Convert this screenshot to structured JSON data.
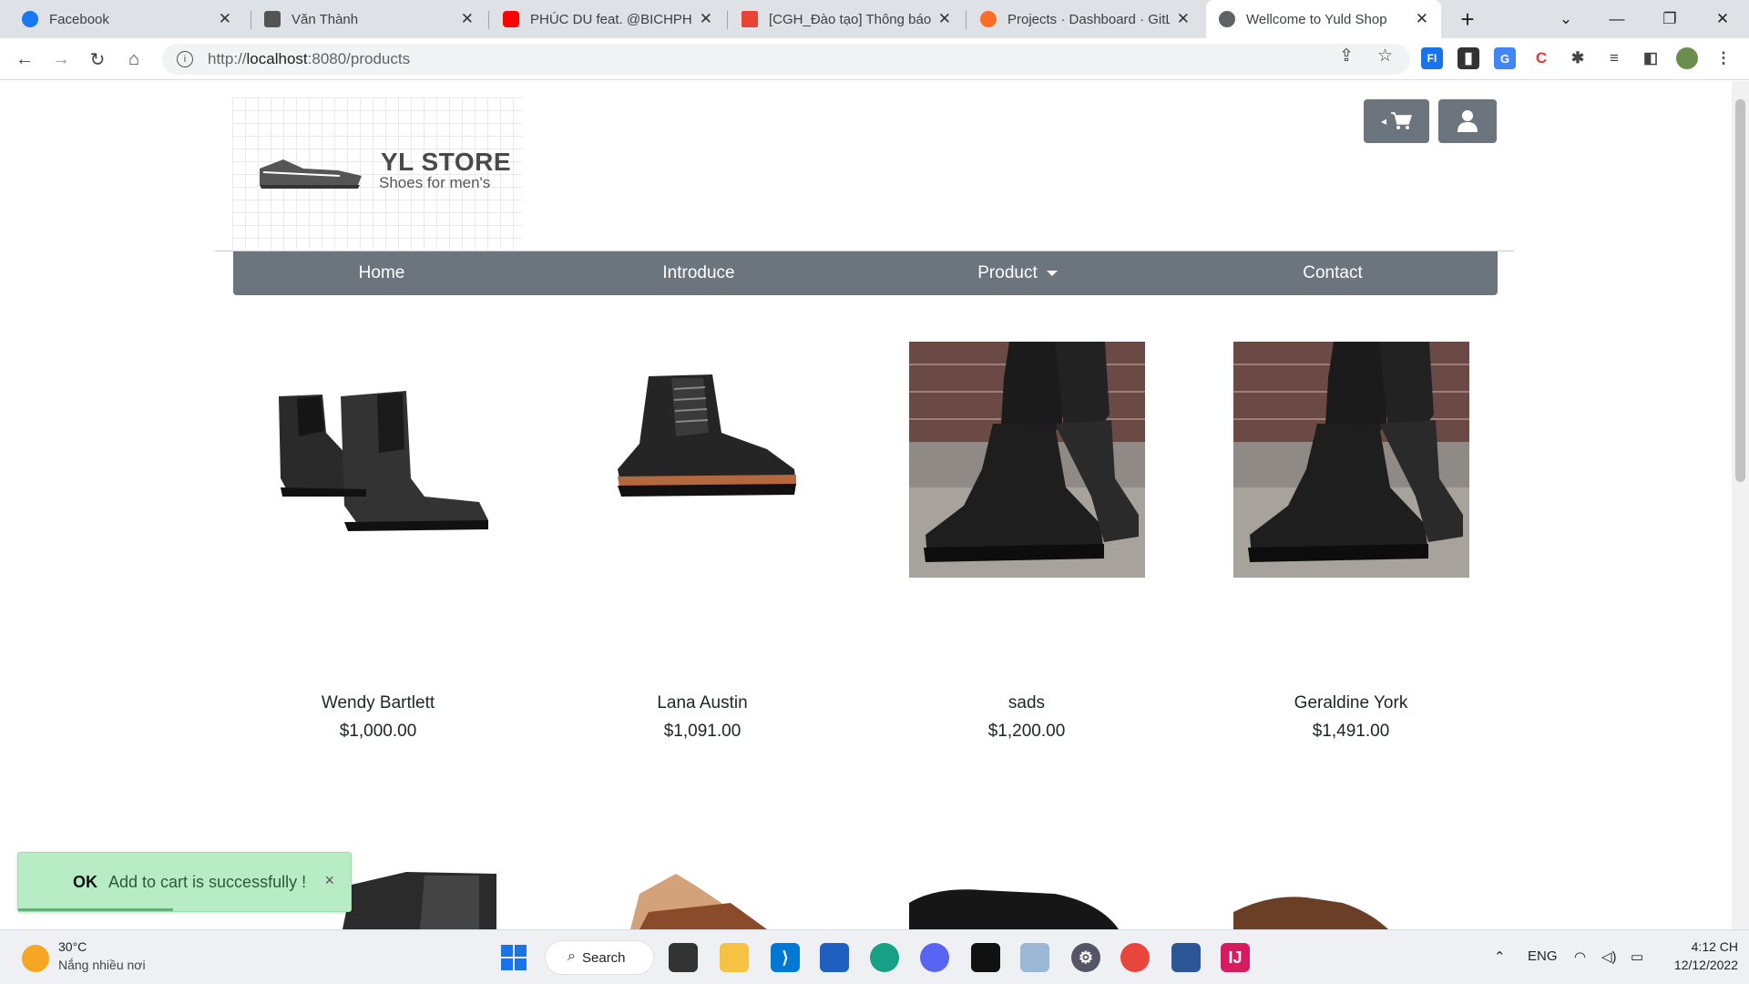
{
  "browser": {
    "tabs": [
      {
        "label": "Facebook",
        "color": "#1877f2"
      },
      {
        "label": "Văn Thành",
        "color": "#555555"
      },
      {
        "label": "PHÚC DU feat. @BICHPHUO",
        "color": "#ff0000"
      },
      {
        "label": "[CGH_Đào tạo] Thông báo y",
        "color": "#ea4335"
      },
      {
        "label": "Projects · Dashboard · GitLa",
        "color": "#fc6d26"
      },
      {
        "label": "Wellcome to Yuld Shop",
        "color": "#5f6368"
      }
    ],
    "url": {
      "protocol": "http://",
      "host": "localhost",
      "path": ":8080/products"
    }
  },
  "header": {
    "logo_title": "YL STORE",
    "logo_subtitle": "Shoes for men's",
    "cart_icon": "cart-icon",
    "user_icon": "user-icon"
  },
  "nav": {
    "items": [
      {
        "label": "Home"
      },
      {
        "label": "Introduce"
      },
      {
        "label": "Product"
      },
      {
        "label": "Contact"
      }
    ]
  },
  "products": [
    {
      "name": "Wendy Bartlett",
      "price": "$1,000.00"
    },
    {
      "name": "Lana Austin",
      "price": "$1,091.00"
    },
    {
      "name": "sads",
      "price": "$1,200.00"
    },
    {
      "name": "Geraldine York",
      "price": "$1,491.00"
    }
  ],
  "toast": {
    "status": "OK",
    "message": "Add to cart is successfully !",
    "close": "×"
  },
  "taskbar": {
    "weather_temp": "30°C",
    "weather_desc": "Nắng nhiều nơi",
    "search_label": "Search",
    "lang": "ENG",
    "time": "4:12 CH",
    "date": "12/12/2022"
  },
  "colors": {
    "nav_bg": "#6c757d",
    "toast_bg": "#b8ecc5"
  }
}
